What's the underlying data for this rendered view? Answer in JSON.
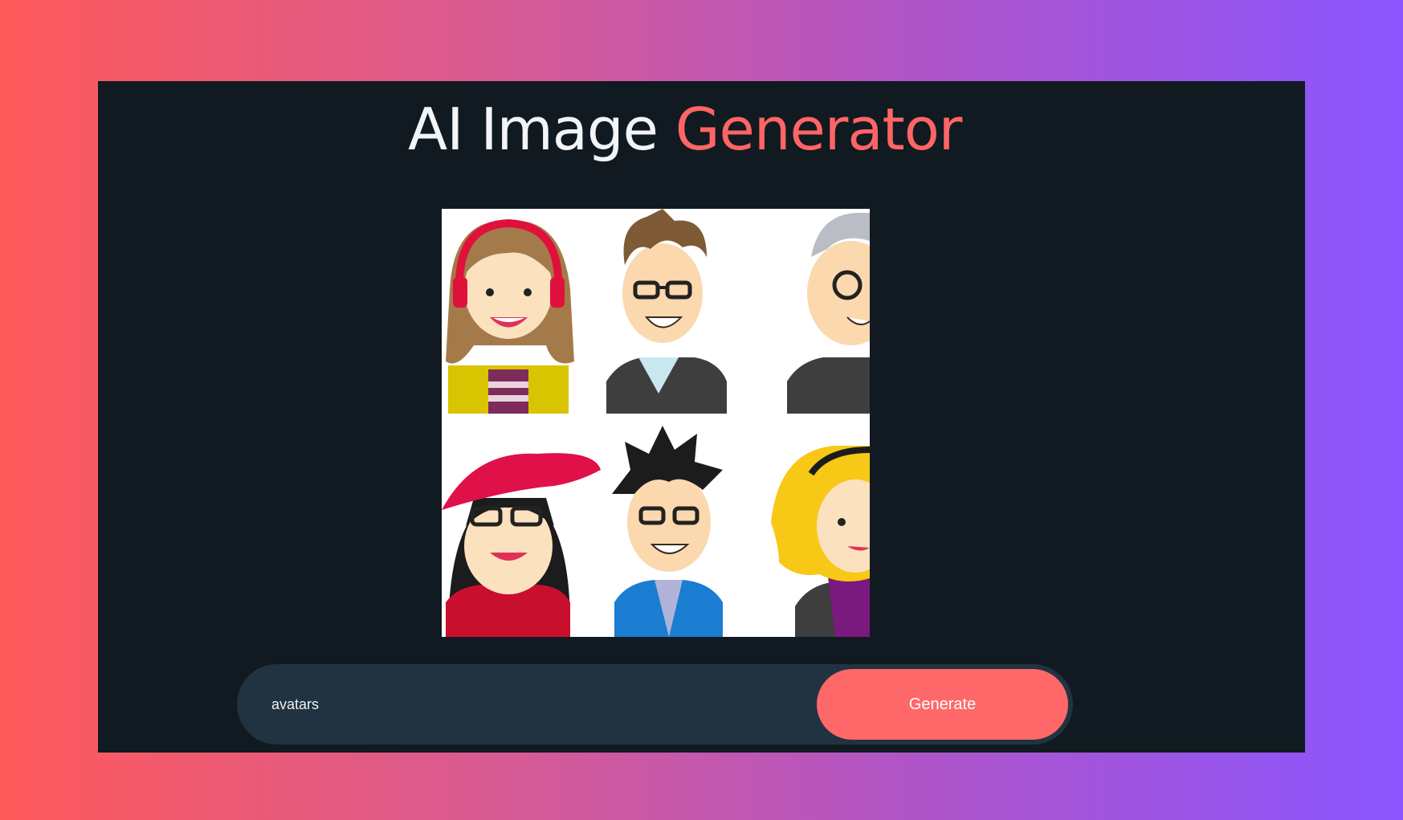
{
  "header": {
    "title_main": "AI Image ",
    "title_accent": "Generator"
  },
  "result_image": {
    "description_icon": "generated-avatars-image"
  },
  "prompt": {
    "value": "avatars"
  },
  "actions": {
    "generate_label": "Generate"
  },
  "colors": {
    "accent": "#ff6868",
    "panel": "#111a21",
    "input_bar": "#213340"
  }
}
